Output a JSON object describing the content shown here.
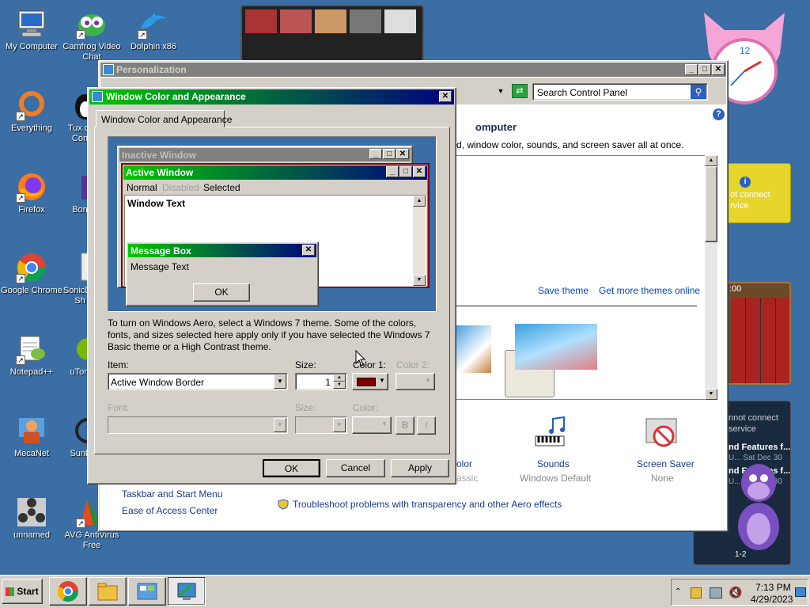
{
  "desktop_icons": [
    {
      "label": "My Computer"
    },
    {
      "label": "Camfrog Video Chat"
    },
    {
      "label": "Dolphin x86"
    },
    {
      "label": "Everything"
    },
    {
      "label": "Tux of Con"
    },
    {
      "label": "Firefox"
    },
    {
      "label": "Bon"
    },
    {
      "label": "Google Chrome"
    },
    {
      "label": "SonicD - Sh"
    },
    {
      "label": "Notepad++"
    },
    {
      "label": "uTorr"
    },
    {
      "label": "MecaNet"
    },
    {
      "label": "Sunk"
    },
    {
      "label": "unnamed"
    },
    {
      "label": "AVG AntiVirus Free"
    }
  ],
  "personalization": {
    "title": "Personalization",
    "search_placeholder": "Search Control Panel",
    "heading_fragment": "omputer",
    "desc_fragment": "d, window color, sounds, and screen saver all at once.",
    "save_theme": "Save theme",
    "more_themes": "Get more themes online",
    "color_label": "olor",
    "color_sub": "assic",
    "sounds_label": "Sounds",
    "sounds_sub": "Windows Default",
    "screensaver_label": "Screen Saver",
    "screensaver_sub": "None",
    "taskbar_link": "Taskbar and Start Menu",
    "ease_link": "Ease of Access Center",
    "troubleshoot_link": "Troubleshoot problems with transparency and other Aero effects"
  },
  "dialog": {
    "title": "Window Color and Appearance",
    "tab": "Window Color and Appearance",
    "preview": {
      "inactive_title": "Inactive Window",
      "active_title": "Active Window",
      "menu_normal": "Normal",
      "menu_disabled": "Disabled",
      "menu_selected": "Selected",
      "window_text": "Window Text",
      "msgbox_title": "Message Box",
      "msgbox_text": "Message Text",
      "msgbox_ok": "OK"
    },
    "info": "To turn on Windows Aero, select a Windows 7 theme.  Some of the colors, fonts, and sizes selected here apply only if you have selected the Windows 7 Basic theme or a High Contrast theme.",
    "item_label": "Item:",
    "item_value": "Active Window Border",
    "size_label": "Size:",
    "size_value": "1",
    "color1_label": "Color 1:",
    "color2_label": "Color 2:",
    "color1_hex": "#800000",
    "font_label": "Font:",
    "font_size_label": "Size:",
    "font_color_label": "Color:",
    "bold_btn": "B",
    "italic_btn": "I",
    "ok": "OK",
    "cancel": "Cancel",
    "apply": "Apply"
  },
  "gadgets": {
    "weather_text": "ot connect rvice",
    "feed_text": "nnot connect service",
    "feed_items": [
      {
        "title": "nd Features f...",
        "meta": "U...   Sat Dec 30"
      },
      {
        "title": "nd Features f...",
        "meta": "U...   Sat Dec 30"
      }
    ],
    "feed_nav": "1-2",
    "puzzle_time": ":00"
  },
  "taskbar": {
    "start": "Start",
    "time": "7:13 PM",
    "date": "4/29/2023"
  },
  "colors": {
    "active_title_start": "#00c800",
    "active_title_end": "#000080",
    "inactive_title": "#808080",
    "desktop": "#3a6ea5"
  }
}
